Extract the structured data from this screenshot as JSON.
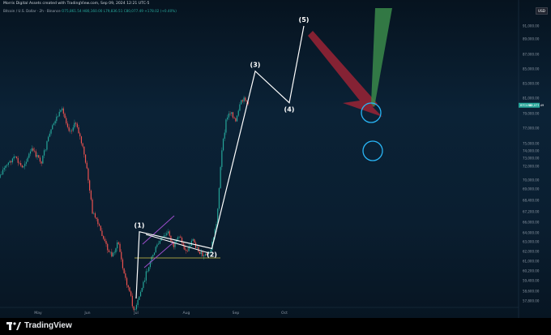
{
  "header": {
    "title": "Morris Digital Assets created with TradingView.com, Sep 09, 2024 12:21 UTC-5",
    "symbol_line": "Bitcoin / U.S. Dollar · 2h · Binance",
    "ohlc": "O75,861.54 H80,160.00 L79,836.51 C80,077.49 +178.02 (+0.40%)",
    "currency": "USD"
  },
  "price_tag": {
    "symbol": "BTCUSD",
    "price": "80,077.49",
    "color": "#26a69a"
  },
  "brand": {
    "name": "TradingView"
  },
  "annotations": {
    "wave1": "(1)",
    "wave2": "(2)",
    "wave3": "(3)",
    "wave4": "(4)",
    "wave5": "(5)"
  },
  "colors": {
    "up": "#26a69a",
    "down": "#ef5350",
    "wave_line": "#ffffff",
    "flag_lines": "#9c4dcc",
    "support_line": "#d4c84a",
    "bear_arrow": "#9b2335",
    "bull_arrow": "#3a8a4a",
    "circle": "#29b6f6"
  },
  "chart_data": {
    "type": "candlestick",
    "x_tick_labels": [
      "May",
      "Jun",
      "Jul",
      "Aug",
      "Sep",
      "Oct"
    ],
    "y_tick_labels": [
      "91,000.00",
      "89,000.00",
      "87,000.00",
      "85,000.00",
      "83,000.00",
      "81,000.00",
      "79,000.00",
      "77,000.00",
      "75,000.00",
      "74,000.00",
      "73,000.00",
      "72,000.00",
      "70,000.00",
      "69,000.00",
      "68,400.00",
      "67,200.00",
      "66,000.00",
      "64,000.00",
      "63,000.00",
      "62,000.00",
      "61,000.00",
      "60,200.00",
      "59,400.00",
      "58,600.00",
      "57,800.00"
    ],
    "price_path": [
      {
        "date": "2024-04-02",
        "price": 69000
      },
      {
        "date": "2024-04-09",
        "price": 71500
      },
      {
        "date": "2024-04-16",
        "price": 73200
      },
      {
        "date": "2024-04-21",
        "price": 71800
      },
      {
        "date": "2024-04-27",
        "price": 74200
      },
      {
        "date": "2024-05-03",
        "price": 72500
      },
      {
        "date": "2024-05-08",
        "price": 76000
      },
      {
        "date": "2024-05-12",
        "price": 78300
      },
      {
        "date": "2024-05-16",
        "price": 79400
      },
      {
        "date": "2024-05-21",
        "price": 76600
      },
      {
        "date": "2024-05-25",
        "price": 77800
      },
      {
        "date": "2024-05-29",
        "price": 74400
      },
      {
        "date": "2024-06-01",
        "price": 71000
      },
      {
        "date": "2024-06-04",
        "price": 67200
      },
      {
        "date": "2024-06-08",
        "price": 65200
      },
      {
        "date": "2024-06-12",
        "price": 62800
      },
      {
        "date": "2024-06-16",
        "price": 61500
      },
      {
        "date": "2024-06-20",
        "price": 63000
      },
      {
        "date": "2024-06-23",
        "price": 60200
      },
      {
        "date": "2024-06-27",
        "price": 58500
      },
      {
        "date": "2024-06-30",
        "price": 56800
      },
      {
        "date": "2024-07-03",
        "price": 58200
      },
      {
        "date": "2024-07-07",
        "price": 59900
      },
      {
        "date": "2024-07-10",
        "price": 61200
      },
      {
        "date": "2024-07-14",
        "price": 62600
      },
      {
        "date": "2024-07-17",
        "price": 63400
      },
      {
        "date": "2024-07-21",
        "price": 64100
      },
      {
        "date": "2024-07-24",
        "price": 62500
      },
      {
        "date": "2024-07-28",
        "price": 63600
      },
      {
        "date": "2024-08-01",
        "price": 61900
      },
      {
        "date": "2024-08-05",
        "price": 63300
      },
      {
        "date": "2024-08-08",
        "price": 62200
      },
      {
        "date": "2024-08-12",
        "price": 61400
      },
      {
        "date": "2024-08-16",
        "price": 62000
      },
      {
        "date": "2024-08-20",
        "price": 66000
      },
      {
        "date": "2024-08-23",
        "price": 73500
      },
      {
        "date": "2024-08-26",
        "price": 78200
      },
      {
        "date": "2024-08-29",
        "price": 79400
      },
      {
        "date": "2024-09-01",
        "price": 77800
      },
      {
        "date": "2024-09-04",
        "price": 80400
      },
      {
        "date": "2024-09-07",
        "price": 81000
      },
      {
        "date": "2024-09-09",
        "price": 80077.49
      }
    ],
    "wave_path": [
      {
        "label": "(1)",
        "date": "2024-07-03",
        "price": 64200
      },
      {
        "label": "(2)",
        "date": "2024-08-17",
        "price": 62300
      },
      {
        "label": "(3)",
        "date": "2024-09-13",
        "price": 84700
      },
      {
        "label": "(4)",
        "date": "2024-10-04",
        "price": 80400
      },
      {
        "label": "(5)",
        "date": "2024-10-13",
        "price": 91000
      }
    ],
    "current_price": 80077.49
  }
}
